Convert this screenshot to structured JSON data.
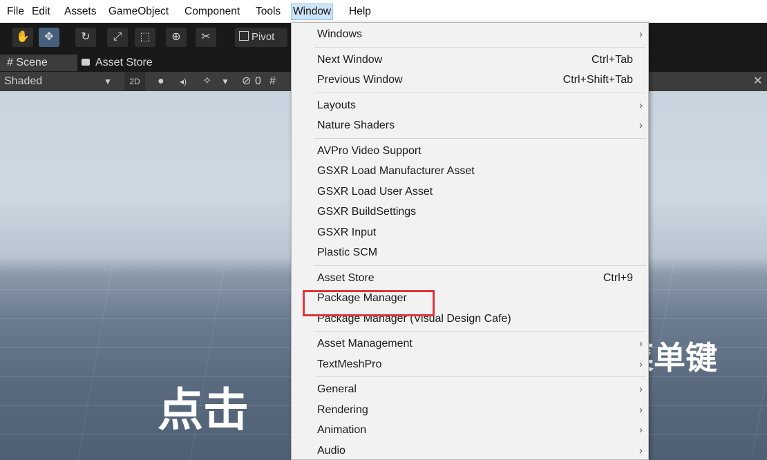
{
  "menubar": {
    "items": [
      "File",
      "Edit",
      "Assets",
      "GameObject",
      "Component",
      "Tools",
      "Window",
      "Help"
    ]
  },
  "toolbar": {
    "tools": [
      "hand-icon",
      "move-icon",
      "rotate-icon",
      "scale-icon",
      "rect-icon",
      "transform-icon",
      "custom-tool-icon"
    ],
    "pivot_label": "Pivot"
  },
  "tabs": {
    "scene": "Scene",
    "asset_store": "Asset Store"
  },
  "scene_toolbar": {
    "shading": "Shaded",
    "mode_2d": "2D",
    "hidden_count": "0"
  },
  "viewport": {
    "overlay_text_left": "点击",
    "overlay_text_right": "菜单键"
  },
  "window_menu": {
    "groups": [
      [
        {
          "label": "Windows",
          "submenu": true
        }
      ],
      [
        {
          "label": "Next Window",
          "shortcut": "Ctrl+Tab"
        },
        {
          "label": "Previous Window",
          "shortcut": "Ctrl+Shift+Tab"
        }
      ],
      [
        {
          "label": "Layouts",
          "submenu": true
        },
        {
          "label": "Nature Shaders",
          "submenu": true
        }
      ],
      [
        {
          "label": "AVPro Video Support"
        },
        {
          "label": "GSXR Load Manufacturer Asset"
        },
        {
          "label": "GSXR Load User Asset"
        },
        {
          "label": "GSXR BuildSettings"
        },
        {
          "label": "GSXR Input"
        },
        {
          "label": "Plastic SCM"
        }
      ],
      [
        {
          "label": "Asset Store",
          "shortcut": "Ctrl+9"
        },
        {
          "label": "Package Manager"
        },
        {
          "label": "Package Manager (Visual Design Cafe)"
        }
      ],
      [
        {
          "label": "Asset Management",
          "submenu": true
        },
        {
          "label": "TextMeshPro",
          "submenu": true
        }
      ],
      [
        {
          "label": "General",
          "submenu": true
        },
        {
          "label": "Rendering",
          "submenu": true
        },
        {
          "label": "Animation",
          "submenu": true
        },
        {
          "label": "Audio",
          "submenu": true
        }
      ]
    ],
    "highlighted": "Package Manager",
    "highlight_color": "#e0343a"
  }
}
